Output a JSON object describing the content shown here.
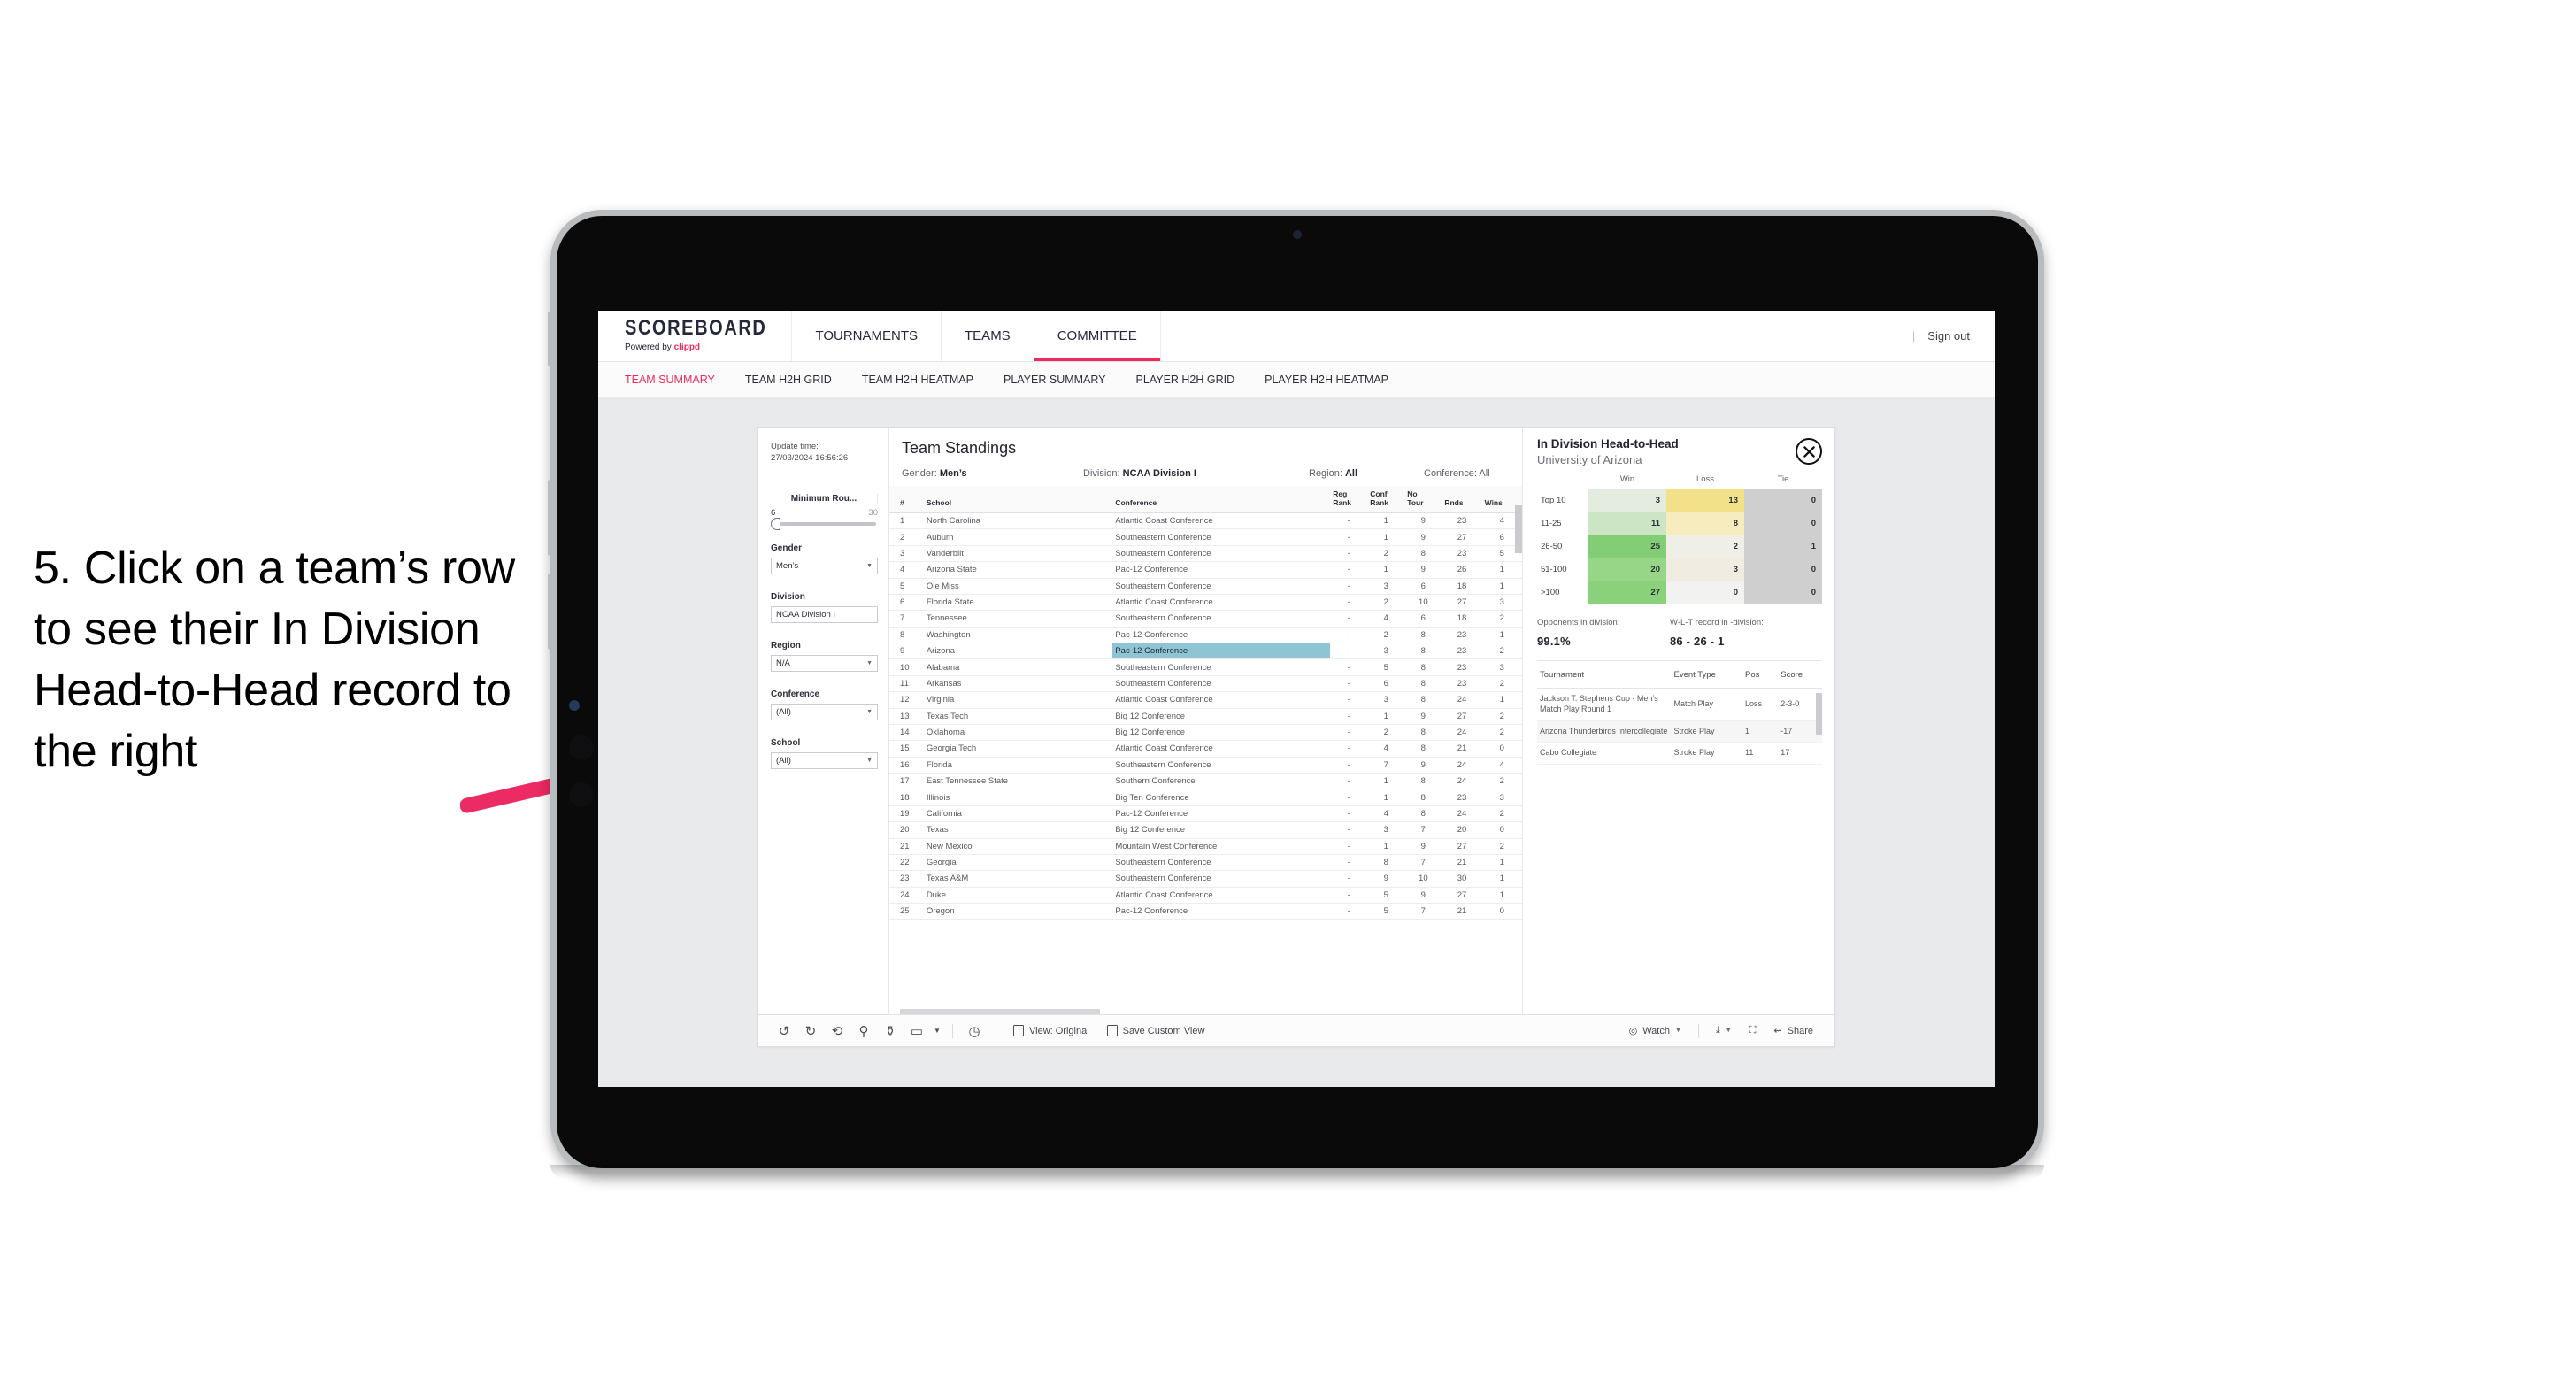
{
  "annotation": {
    "text": "5. Click on a team’s row to see their In Division Head-to-Head record to the right",
    "arrow_color": "#ec2a63"
  },
  "topnav": {
    "brand_title": "SCOREBOARD",
    "brand_sub_prefix": "Powered by ",
    "brand_sub_brand": "clippd",
    "items": [
      {
        "label": "TOURNAMENTS",
        "active": false
      },
      {
        "label": "TEAMS",
        "active": false
      },
      {
        "label": "COMMITTEE",
        "active": true
      }
    ],
    "separator": "|",
    "sign_out": "Sign out"
  },
  "subnav": {
    "items": [
      {
        "label": "TEAM SUMMARY",
        "active": true
      },
      {
        "label": "TEAM H2H GRID",
        "active": false
      },
      {
        "label": "TEAM H2H HEATMAP",
        "active": false
      },
      {
        "label": "PLAYER SUMMARY",
        "active": false
      },
      {
        "label": "PLAYER H2H GRID",
        "active": false
      },
      {
        "label": "PLAYER H2H HEATMAP",
        "active": false
      }
    ]
  },
  "rail": {
    "update_label": "Update time:",
    "update_value": "27/03/2024 16:56:26",
    "slider": {
      "label": "Minimum Rou...",
      "min": "6",
      "max": "30"
    },
    "filters": [
      {
        "label": "Gender",
        "value": "Men’s"
      },
      {
        "label": "Division",
        "value": "NCAA Division I"
      },
      {
        "label": "Region",
        "value": "N/A"
      },
      {
        "label": "Conference",
        "value": "(All)"
      },
      {
        "label": "School",
        "value": "(All)"
      }
    ]
  },
  "standings": {
    "title": "Team Standings",
    "meta": [
      {
        "key": "Gender: ",
        "value": "Men’s"
      },
      {
        "key": "Division: ",
        "value": "NCAA Division I"
      },
      {
        "key": "Region: ",
        "value": "All"
      },
      {
        "key": "Conference: ",
        "value": "All"
      }
    ],
    "columns": [
      "#",
      "School",
      "Conference",
      "Reg Rank",
      "Conf Rank",
      "No Tour",
      "Rnds",
      "Wins"
    ],
    "highlighted_row": 9,
    "rows": [
      {
        "rank": "1",
        "school": "North Carolina",
        "conference": "Atlantic Coast Conference",
        "reg": "-",
        "conf": "1",
        "notour": "9",
        "rnds": "23",
        "wins": "4"
      },
      {
        "rank": "2",
        "school": "Auburn",
        "conference": "Southeastern Conference",
        "reg": "-",
        "conf": "1",
        "notour": "9",
        "rnds": "27",
        "wins": "6"
      },
      {
        "rank": "3",
        "school": "Vanderbilt",
        "conference": "Southeastern Conference",
        "reg": "-",
        "conf": "2",
        "notour": "8",
        "rnds": "23",
        "wins": "5"
      },
      {
        "rank": "4",
        "school": "Arizona State",
        "conference": "Pac-12 Conference",
        "reg": "-",
        "conf": "1",
        "notour": "9",
        "rnds": "26",
        "wins": "1"
      },
      {
        "rank": "5",
        "school": "Ole Miss",
        "conference": "Southeastern Conference",
        "reg": "-",
        "conf": "3",
        "notour": "6",
        "rnds": "18",
        "wins": "1"
      },
      {
        "rank": "6",
        "school": "Florida State",
        "conference": "Atlantic Coast Conference",
        "reg": "-",
        "conf": "2",
        "notour": "10",
        "rnds": "27",
        "wins": "3"
      },
      {
        "rank": "7",
        "school": "Tennessee",
        "conference": "Southeastern Conference",
        "reg": "-",
        "conf": "4",
        "notour": "6",
        "rnds": "18",
        "wins": "2"
      },
      {
        "rank": "8",
        "school": "Washington",
        "conference": "Pac-12 Conference",
        "reg": "-",
        "conf": "2",
        "notour": "8",
        "rnds": "23",
        "wins": "1"
      },
      {
        "rank": "9",
        "school": "Arizona",
        "conference": "Pac-12 Conference",
        "reg": "-",
        "conf": "3",
        "notour": "8",
        "rnds": "23",
        "wins": "2"
      },
      {
        "rank": "10",
        "school": "Alabama",
        "conference": "Southeastern Conference",
        "reg": "-",
        "conf": "5",
        "notour": "8",
        "rnds": "23",
        "wins": "3"
      },
      {
        "rank": "11",
        "school": "Arkansas",
        "conference": "Southeastern Conference",
        "reg": "-",
        "conf": "6",
        "notour": "8",
        "rnds": "23",
        "wins": "2"
      },
      {
        "rank": "12",
        "school": "Virginia",
        "conference": "Atlantic Coast Conference",
        "reg": "-",
        "conf": "3",
        "notour": "8",
        "rnds": "24",
        "wins": "1"
      },
      {
        "rank": "13",
        "school": "Texas Tech",
        "conference": "Big 12 Conference",
        "reg": "-",
        "conf": "1",
        "notour": "9",
        "rnds": "27",
        "wins": "2"
      },
      {
        "rank": "14",
        "school": "Oklahoma",
        "conference": "Big 12 Conference",
        "reg": "-",
        "conf": "2",
        "notour": "8",
        "rnds": "24",
        "wins": "2"
      },
      {
        "rank": "15",
        "school": "Georgia Tech",
        "conference": "Atlantic Coast Conference",
        "reg": "-",
        "conf": "4",
        "notour": "8",
        "rnds": "21",
        "wins": "0"
      },
      {
        "rank": "16",
        "school": "Florida",
        "conference": "Southeastern Conference",
        "reg": "-",
        "conf": "7",
        "notour": "9",
        "rnds": "24",
        "wins": "4"
      },
      {
        "rank": "17",
        "school": "East Tennessee State",
        "conference": "Southern Conference",
        "reg": "-",
        "conf": "1",
        "notour": "8",
        "rnds": "24",
        "wins": "2"
      },
      {
        "rank": "18",
        "school": "Illinois",
        "conference": "Big Ten Conference",
        "reg": "-",
        "conf": "1",
        "notour": "8",
        "rnds": "23",
        "wins": "3"
      },
      {
        "rank": "19",
        "school": "California",
        "conference": "Pac-12 Conference",
        "reg": "-",
        "conf": "4",
        "notour": "8",
        "rnds": "24",
        "wins": "2"
      },
      {
        "rank": "20",
        "school": "Texas",
        "conference": "Big 12 Conference",
        "reg": "-",
        "conf": "3",
        "notour": "7",
        "rnds": "20",
        "wins": "0"
      },
      {
        "rank": "21",
        "school": "New Mexico",
        "conference": "Mountain West Conference",
        "reg": "-",
        "conf": "1",
        "notour": "9",
        "rnds": "27",
        "wins": "2"
      },
      {
        "rank": "22",
        "school": "Georgia",
        "conference": "Southeastern Conference",
        "reg": "-",
        "conf": "8",
        "notour": "7",
        "rnds": "21",
        "wins": "1"
      },
      {
        "rank": "23",
        "school": "Texas A&M",
        "conference": "Southeastern Conference",
        "reg": "-",
        "conf": "9",
        "notour": "10",
        "rnds": "30",
        "wins": "1"
      },
      {
        "rank": "24",
        "school": "Duke",
        "conference": "Atlantic Coast Conference",
        "reg": "-",
        "conf": "5",
        "notour": "9",
        "rnds": "27",
        "wins": "1"
      },
      {
        "rank": "25",
        "school": "Oregon",
        "conference": "Pac-12 Conference",
        "reg": "-",
        "conf": "5",
        "notour": "7",
        "rnds": "21",
        "wins": "0"
      }
    ]
  },
  "h2h": {
    "title": "In Division Head-to-Head",
    "subtitle": "University of Arizona",
    "close_icon": "close-circle-icon",
    "stats": [
      {
        "key": "Opponents in division:",
        "value": "99.1%"
      },
      {
        "key": "W-L-T record in -division:",
        "value": "86 - 26 - 1"
      }
    ],
    "tournaments": {
      "columns": [
        "Tournament",
        "Event Type",
        "Pos",
        "Score"
      ],
      "rows": [
        {
          "name": "Jackson T. Stephens Cup - Men’s Match Play Round 1",
          "type": "Match Play",
          "pos": "Loss",
          "score": "2-3-0"
        },
        {
          "name": "Arizona Thunderbirds Intercollegiate",
          "type": "Stroke Play",
          "pos": "1",
          "score": "-17"
        },
        {
          "name": "Cabo Collegiate",
          "type": "Stroke Play",
          "pos": "11",
          "score": "17"
        }
      ]
    }
  },
  "chart_data": {
    "type": "heatmap",
    "title": "In Division Head-to-Head",
    "subtitle": "University of Arizona",
    "columns": [
      "Win",
      "Loss",
      "Tie"
    ],
    "categories": [
      "Top 10",
      "11-25",
      "26-50",
      "51-100",
      ">100"
    ],
    "series": [
      {
        "name": "Win",
        "values": [
          3,
          11,
          25,
          20,
          27
        ]
      },
      {
        "name": "Loss",
        "values": [
          13,
          8,
          2,
          3,
          0
        ]
      },
      {
        "name": "Tie",
        "values": [
          0,
          0,
          1,
          0,
          0
        ]
      }
    ],
    "cell_colors": {
      "win": [
        "#e3ecdf",
        "#cce5c4",
        "#83cd75",
        "#96d686",
        "#8bd17c"
      ],
      "loss": [
        "#f3e18a",
        "#f6ecbe",
        "#efefe7",
        "#f0ece2",
        "#f2f2f0"
      ],
      "tie": [
        "#cfcfcf",
        "#cfcfcf",
        "#cfcfcf",
        "#cfcfcf",
        "#cfcfcf"
      ]
    },
    "legend_position": "top",
    "grid": false
  },
  "toolbar": {
    "icons": [
      "undo-icon",
      "redo-icon",
      "revert-icon",
      "refresh-data-icon",
      "pause-updates-icon",
      "device-layout-icon"
    ],
    "alerts_icon": "alerts-icon",
    "view_label": "View: Original",
    "view_icon": "view-original-icon",
    "save_label": "Save Custom View",
    "save_icon": "save-view-icon",
    "watch_label": "Watch",
    "watch_icon": "watch-icon",
    "download_icon": "download-icon",
    "fullscreen_icon": "fullscreen-icon",
    "share_label": "Share",
    "share_icon": "share-icon"
  }
}
